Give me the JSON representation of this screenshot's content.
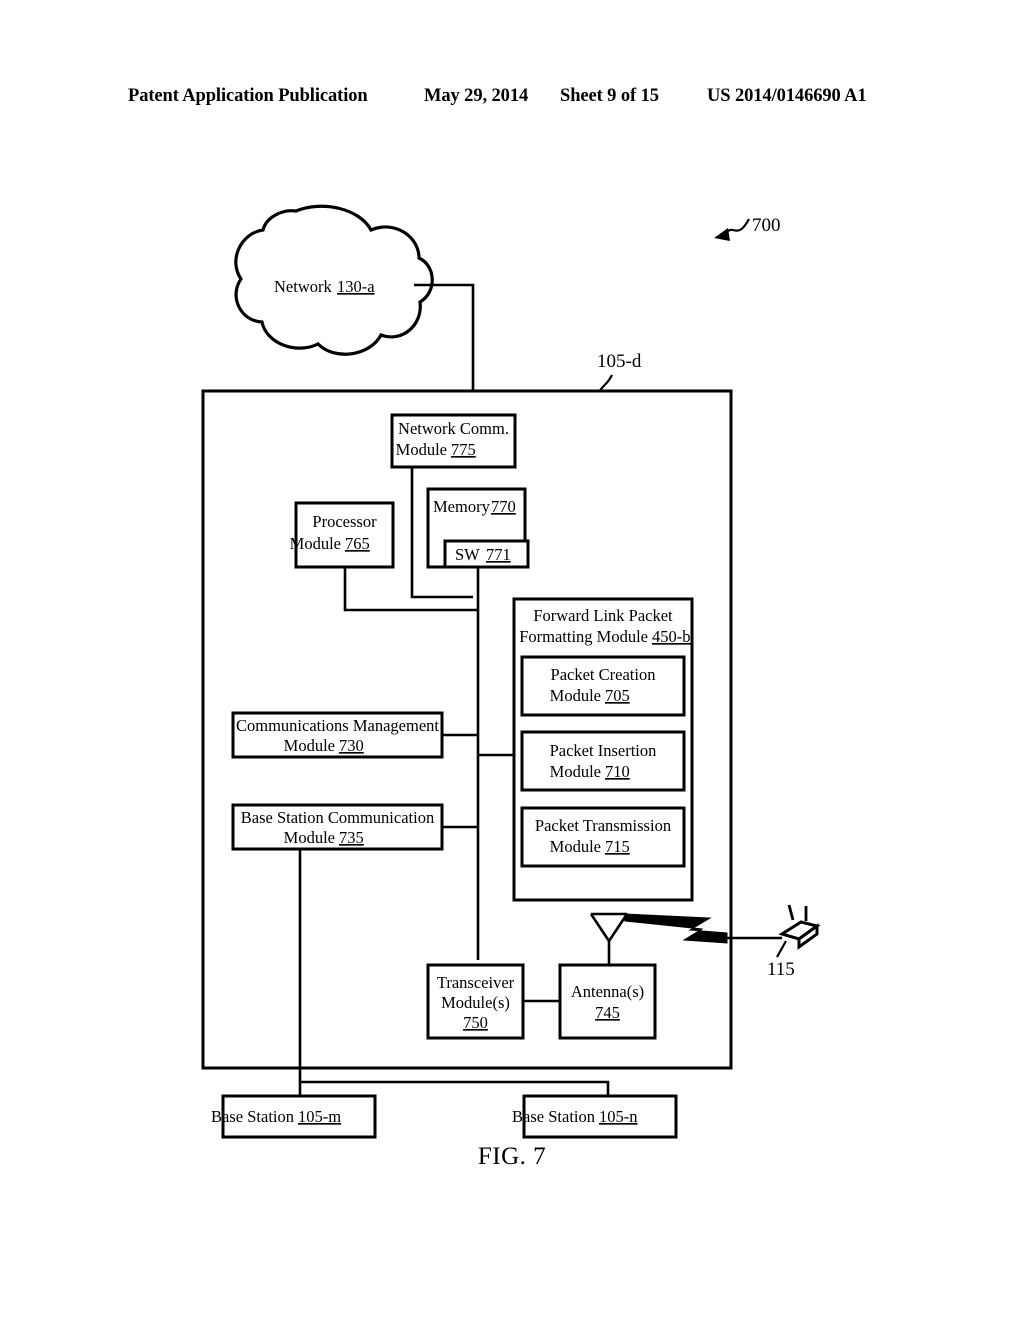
{
  "header": {
    "publication": "Patent Application Publication",
    "date": "May 29, 2014",
    "sheet": "Sheet 9 of 15",
    "patent_number": "US 2014/0146690 A1"
  },
  "figure": {
    "caption": "FIG. 7",
    "system_reference": "700",
    "device_reference": "105-d",
    "mobile_device_reference": "115"
  },
  "colors": {
    "ink": "#000000",
    "paper": "#ffffff"
  },
  "network_cloud": {
    "label": "Network",
    "ref": "130-a"
  },
  "modules": {
    "network_comm": {
      "line1": "Network Comm.",
      "line2": "Module",
      "ref": "775"
    },
    "processor": {
      "line1": "Processor",
      "line2": "Module",
      "ref": "765"
    },
    "memory": {
      "line1": "Memory",
      "ref": "770"
    },
    "software": {
      "line1": "SW",
      "ref": "771"
    },
    "forward_link": {
      "line1": "Forward Link Packet",
      "line2": "Formatting Module",
      "ref": "450-b"
    },
    "packet_creation": {
      "line1": "Packet Creation",
      "line2": "Module",
      "ref": "705"
    },
    "packet_insertion": {
      "line1": "Packet Insertion",
      "line2": "Module",
      "ref": "710"
    },
    "packet_transmission": {
      "line1": "Packet Transmission",
      "line2": "Module",
      "ref": "715"
    },
    "comms_management": {
      "line1": "Communications Management",
      "line2": "Module",
      "ref": "730"
    },
    "base_station_comm": {
      "line1": "Base Station Communication",
      "line2": "Module",
      "ref": "735"
    },
    "transceiver": {
      "line1": "Transceiver",
      "line2": "Module(s)",
      "ref": "750"
    },
    "antenna": {
      "line1": "Antenna(s)",
      "ref": "745"
    }
  },
  "base_stations": [
    {
      "label": "Base Station",
      "ref": "105-m"
    },
    {
      "label": "Base Station",
      "ref": "105-n"
    }
  ]
}
